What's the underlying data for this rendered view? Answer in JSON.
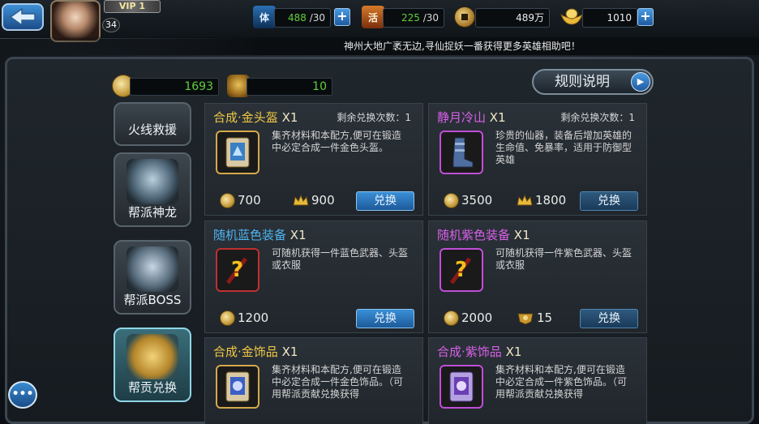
{
  "header": {
    "vip_label": "VIP 1",
    "player_level": "34",
    "stamina": {
      "icon_text": "体",
      "value": "488",
      "max": "/30"
    },
    "vitality": {
      "icon_text": "活",
      "value": "225",
      "max": "/30"
    },
    "coins": {
      "value": "489万"
    },
    "gold": {
      "value": "1010"
    },
    "plus": "+"
  },
  "notice": "神州大地广袤无边,寻仙捉妖一番获得更多英雄相助吧！",
  "currency": {
    "contribution": "1693",
    "token": "10"
  },
  "rules_button": "规则说明",
  "side_tabs": [
    {
      "label": "火线救援"
    },
    {
      "label": "帮派神龙"
    },
    {
      "label": "帮派BOSS"
    },
    {
      "label": "帮贡兑换"
    }
  ],
  "cards": [
    {
      "name": "合成·金头盔",
      "qty": "X1",
      "name_color": "#f0c845",
      "remain": "剩余兑换次数：1",
      "desc": "集齐材料和本配方,便可在锻造中必定合成一件金色头盔。",
      "price1": "700",
      "price2": "900",
      "price2_type": "crown",
      "button": "兑换"
    },
    {
      "name": "静月冷山",
      "qty": "X1",
      "name_color": "#d860e8",
      "remain": "剩余兑换次数：1",
      "desc": "珍贵的仙器，装备后增加英雄的生命值、免暴率，适用于防御型英雄",
      "price1": "3500",
      "price2": "1800",
      "price2_type": "crown",
      "button": "兑换"
    },
    {
      "name": "随机蓝色装备",
      "qty": "X1",
      "name_color": "#4fb4f0",
      "remain": "",
      "desc": "可随机获得一件蓝色武器、头盔或衣服",
      "price1": "1200",
      "price2": "",
      "price2_type": "",
      "button": "兑换"
    },
    {
      "name": "随机紫色装备",
      "qty": "X1",
      "name_color": "#d860e8",
      "remain": "",
      "desc": "可随机获得一件紫色武器、头盔或衣服",
      "price1": "2000",
      "price2": "15",
      "price2_type": "badge",
      "button": "兑换"
    },
    {
      "name": "合成·金饰品",
      "qty": "X1",
      "name_color": "#f0c845",
      "remain": "",
      "desc": "集齐材料和本配方,便可在锻造中必定合成一件金色饰品。（可用帮派贡献兑换获得",
      "price1": "",
      "price2": "",
      "price2_type": "",
      "button": ""
    },
    {
      "name": "合成·紫饰品",
      "qty": "X1",
      "name_color": "#d860e8",
      "remain": "",
      "desc": "集齐材料和本配方,便可在锻造中必定合成一件紫色饰品。（可用帮派贡献兑换获得",
      "price1": "",
      "price2": "",
      "price2_type": "",
      "button": ""
    }
  ],
  "chat_button": "•••"
}
